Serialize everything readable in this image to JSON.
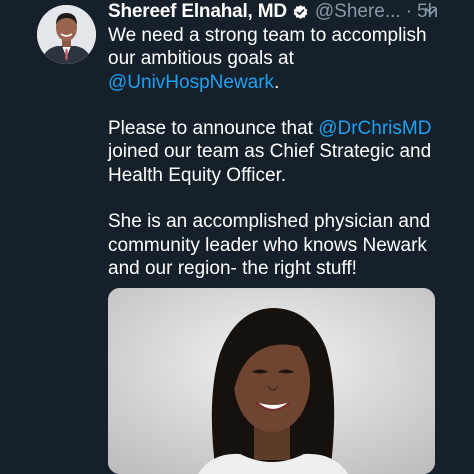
{
  "tweet": {
    "author_name": "Shereef Elnahal, MD",
    "handle": "@Shere...",
    "separator": "·",
    "time": "5h",
    "line1": "We need a strong team to accomplish our ambitious goals at",
    "mention1": "@UnivHospNewark",
    "line1_end": ".",
    "line2_start": "Please to announce that",
    "mention2": "@DrChrisMD",
    "line2_end": "joined our team as Chief Strategic and Health Equity Officer.",
    "line3": "She is an accomplished physician and community leader who knows Newark and our region- the right stuff!"
  },
  "icons": {
    "verified": "verified-badge-icon",
    "chevron": "chevron-down-icon"
  },
  "colors": {
    "background": "#15202b",
    "text": "#ffffff",
    "secondary": "#8899a6",
    "link": "#1da1f2",
    "verified": "#1da1f2"
  }
}
